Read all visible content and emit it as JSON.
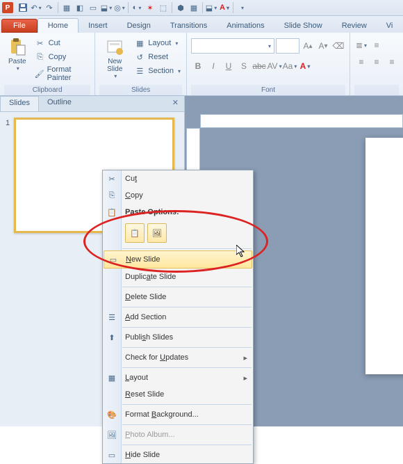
{
  "qat": {
    "app": "P"
  },
  "tabs": {
    "file": "File",
    "home": "Home",
    "insert": "Insert",
    "design": "Design",
    "transitions": "Transitions",
    "animations": "Animations",
    "slideshow": "Slide Show",
    "review": "Review",
    "view": "Vi"
  },
  "ribbon": {
    "clipboard": {
      "label": "Clipboard",
      "paste": "Paste",
      "cut": "Cut",
      "copy": "Copy",
      "format_painter": "Format Painter"
    },
    "slides": {
      "label": "Slides",
      "new_slide": "New\nSlide",
      "layout": "Layout",
      "reset": "Reset",
      "section": "Section"
    },
    "font": {
      "label": "Font",
      "B": "B",
      "I": "I",
      "U": "U",
      "S": "S",
      "abc": "abc"
    }
  },
  "pane": {
    "slides": "Slides",
    "outline": "Outline",
    "num": "1"
  },
  "context": {
    "cut": "Cut",
    "copy": "Copy",
    "paste_options": "Paste Options:",
    "new_slide": "New Slide",
    "duplicate": "Duplicate Slide",
    "delete": "Delete Slide",
    "add_section": "Add Section",
    "publish": "Publish Slides",
    "updates": "Check for Updates",
    "layout": "Layout",
    "reset": "Reset Slide",
    "format_bg": "Format Background...",
    "photo": "Photo Album...",
    "hide": "Hide Slide"
  }
}
